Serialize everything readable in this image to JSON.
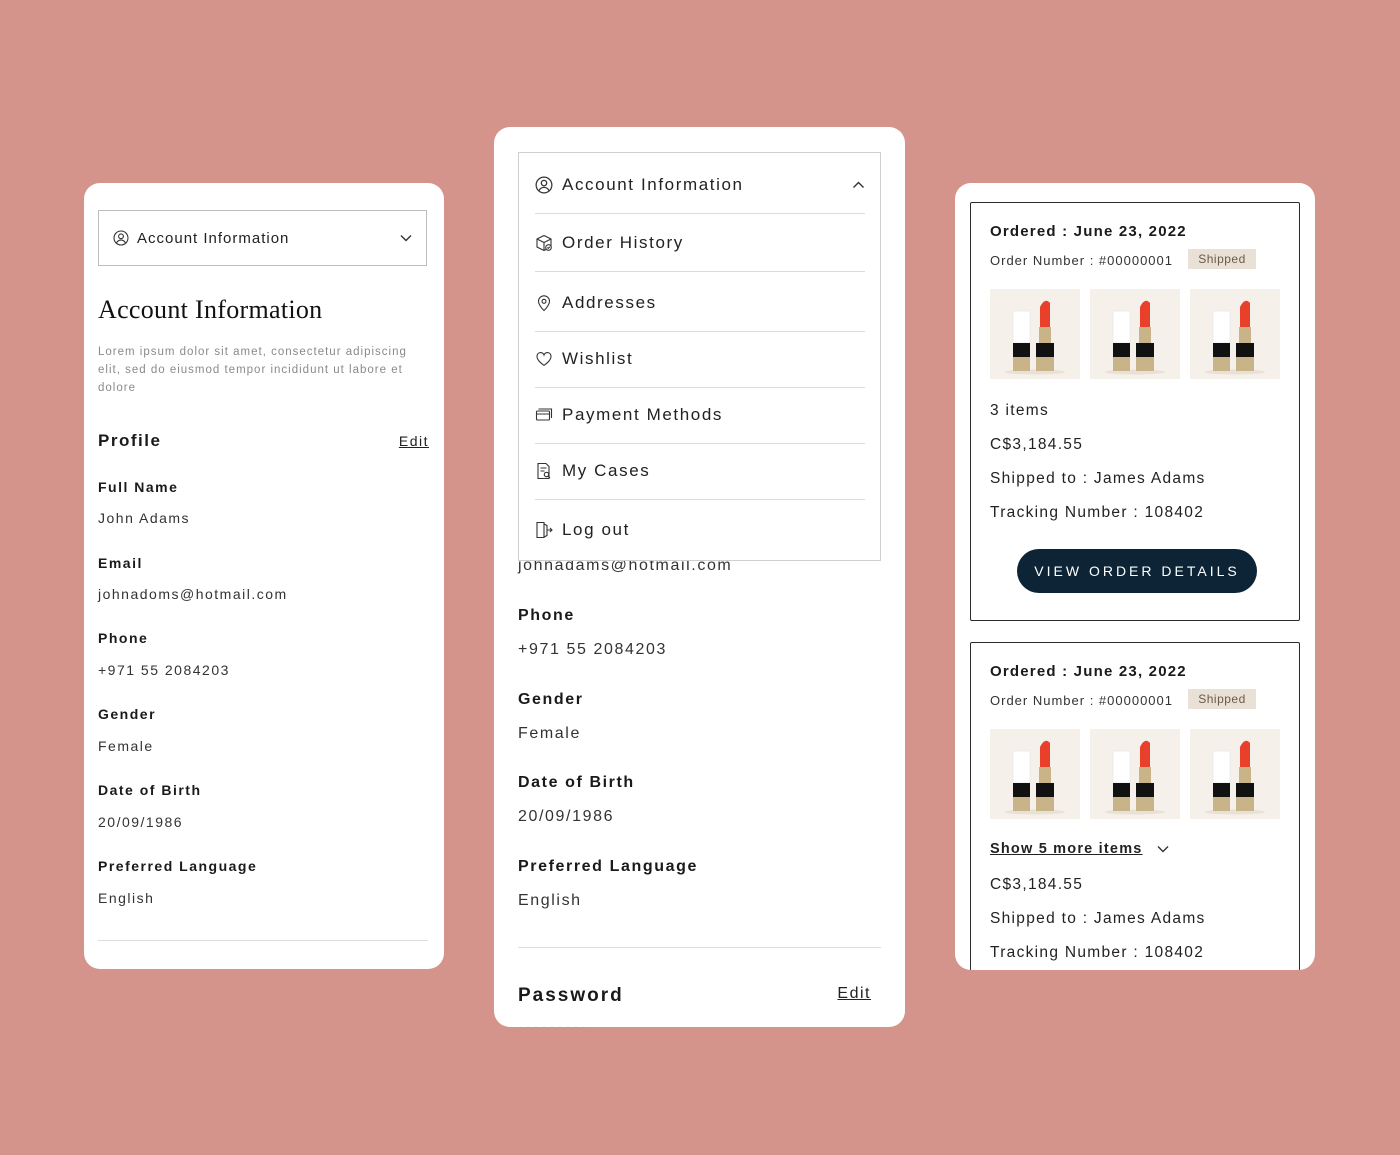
{
  "panel1": {
    "dropdown_label": "Account Information",
    "title": "Account Information",
    "description": "Lorem ipsum dolor sit amet, consectetur adipiscing elit, sed do eiusmod tempor incididunt ut labore et dolore",
    "profile_heading": "Profile",
    "edit_label": "Edit",
    "fields": [
      {
        "label": "Full Name",
        "value": "John Adams"
      },
      {
        "label": "Email",
        "value": "johnadoms@hotmail.com"
      },
      {
        "label": "Phone",
        "value": "+971 55 2084203"
      },
      {
        "label": "Gender",
        "value": "Female"
      },
      {
        "label": "Date of Birth",
        "value": "20/09/1986"
      },
      {
        "label": "Preferred Language",
        "value": "English"
      }
    ]
  },
  "panel2": {
    "menu": [
      {
        "label": "Account Information",
        "icon": "user-circle-icon"
      },
      {
        "label": "Order History",
        "icon": "package-icon"
      },
      {
        "label": "Addresses",
        "icon": "location-pin-icon"
      },
      {
        "label": "Wishlist",
        "icon": "heart-icon"
      },
      {
        "label": "Payment Methods",
        "icon": "credit-card-icon"
      },
      {
        "label": "My Cases",
        "icon": "document-icon"
      },
      {
        "label": "Log out",
        "icon": "logout-icon"
      }
    ],
    "email_value": "johnadams@hotmail.com",
    "fields": [
      {
        "label": "Phone",
        "value": "+971 55 2084203"
      },
      {
        "label": "Gender",
        "value": "Female"
      },
      {
        "label": "Date of Birth",
        "value": "20/09/1986"
      },
      {
        "label": "Preferred Language",
        "value": "English"
      }
    ],
    "password_heading": "Password",
    "edit_label": "Edit"
  },
  "panel3": {
    "orders": [
      {
        "date": "Ordered : June 23, 2022",
        "order_number": "Order Number : #00000001",
        "status": "Shipped",
        "items_text": "3 items",
        "price": "C$3,184.55",
        "shipped_to": "Shipped to : James Adams",
        "tracking": "Tracking Number : 108402",
        "button": "VIEW ORDER DETAILS"
      },
      {
        "date": "Ordered : June 23, 2022",
        "order_number": "Order Number : #00000001",
        "status": "Shipped",
        "show_more": "Show 5 more items",
        "price": "C$3,184.55",
        "shipped_to": "Shipped to : James Adams",
        "tracking": "Tracking Number : 108402"
      }
    ]
  },
  "colors": {
    "background": "#d4948b",
    "button": "#0c2435",
    "badge_bg": "#eae1d6",
    "lipstick": "#e8402a",
    "gold": "#c9b48a"
  }
}
